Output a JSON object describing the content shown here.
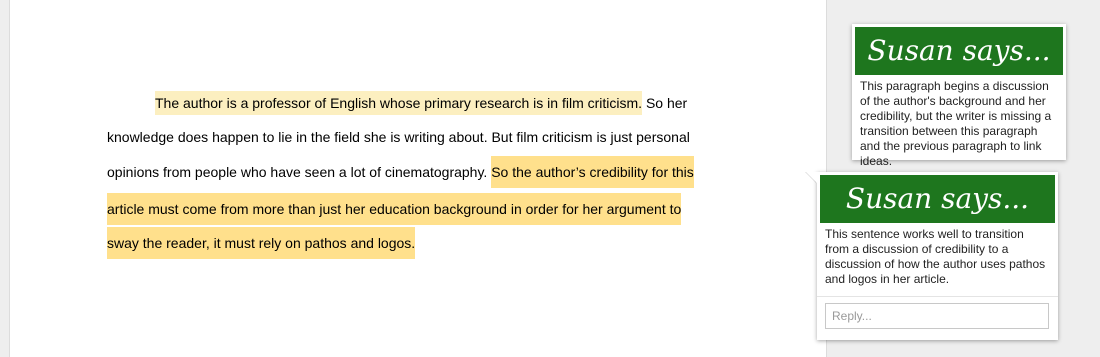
{
  "document": {
    "lines": [
      {
        "segments": [
          {
            "text": "The author is a professor of English whose primary research is in film criticism.",
            "highlight": "light"
          },
          {
            "text": " So her",
            "highlight": "none"
          }
        ]
      },
      {
        "segments": [
          {
            "text": "knowledge does happen to lie in the field she is writing about. But film criticism is just personal",
            "highlight": "none"
          }
        ]
      },
      {
        "segments": [
          {
            "text": "opinions from people who have seen a lot of cinematography. ",
            "highlight": "none"
          },
          {
            "text": "So the author’s credibility for this",
            "highlight": "strong"
          }
        ]
      },
      {
        "segments": [
          {
            "text": "article must come from more than just her education background in order for her argument to",
            "highlight": "strong"
          }
        ]
      },
      {
        "segments": [
          {
            "text": "sway the reader, it must rely on pathos and logos.",
            "highlight": "strong"
          }
        ]
      }
    ]
  },
  "comments": [
    {
      "header": "Susan says...",
      "body": "This paragraph begins a discussion of the author's background and her credibility, but the writer is missing a transition between this paragraph and the previous paragraph to link ideas."
    },
    {
      "header": "Susan says...",
      "body": "This sentence works well to transition from a discussion of credibility to a discussion of how the author uses pathos and logos in her article.",
      "reply_placeholder": "Reply..."
    }
  ],
  "colors": {
    "highlight_light": "#fcefc0",
    "highlight_strong": "#ffe08c",
    "header_green": "#1e761e"
  }
}
